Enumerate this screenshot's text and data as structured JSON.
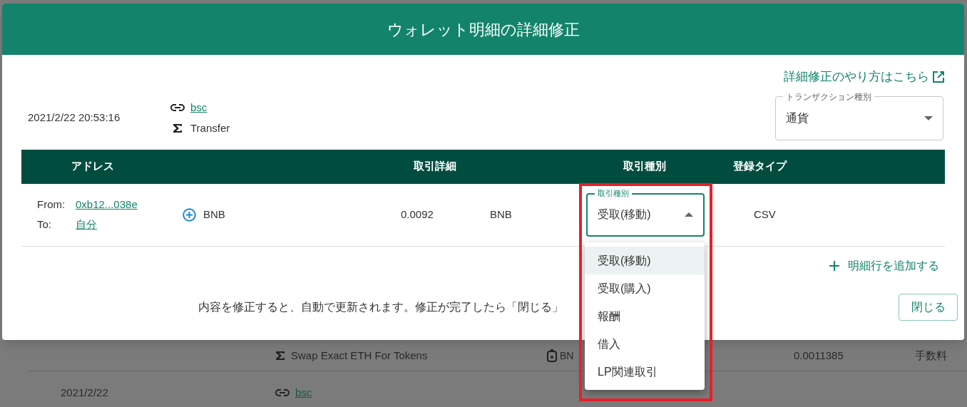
{
  "background": {
    "rows": [
      {
        "method": "Swap Exact ETH For Tokens",
        "asset": "BN",
        "amount": "0.0011385",
        "category": "手数料"
      },
      {
        "date": "2021/2/22",
        "network": "bsc"
      }
    ]
  },
  "dialog": {
    "title": "ウォレット明細の詳細修正",
    "help_link": "詳細修正のやり方はこちら",
    "datetime": "2021/2/22 20:53:16",
    "network_link": "bsc",
    "method": "Transfer",
    "transaction_type": {
      "label": "トランザクション種別",
      "value": "通貨"
    },
    "table": {
      "columns": [
        "アドレス",
        "取引詳細",
        "取引種別",
        "登録タイプ"
      ],
      "rows": [
        {
          "from_label": "From:",
          "from": "0xb12...038e",
          "to_label": "To:",
          "to": "自分",
          "asset": "BNB",
          "amount": "0.0092",
          "unit": "BNB",
          "trade_type": {
            "label": "取引種別",
            "value": "受取(移動)",
            "expanded": true
          },
          "registration": "CSV"
        }
      ]
    },
    "add_row": "明細行を追加する",
    "footer_note": "内容を修正すると、自動で更新されます。修正が完了したら「閉じる」",
    "close": "閉じる"
  },
  "dropdown": {
    "options": [
      {
        "label": "受取(移動)",
        "selected": true
      },
      {
        "label": "受取(購入)",
        "selected": false
      },
      {
        "label": "報酬",
        "selected": false
      },
      {
        "label": "借入",
        "selected": false
      },
      {
        "label": "LP関連取引",
        "selected": false
      }
    ]
  }
}
